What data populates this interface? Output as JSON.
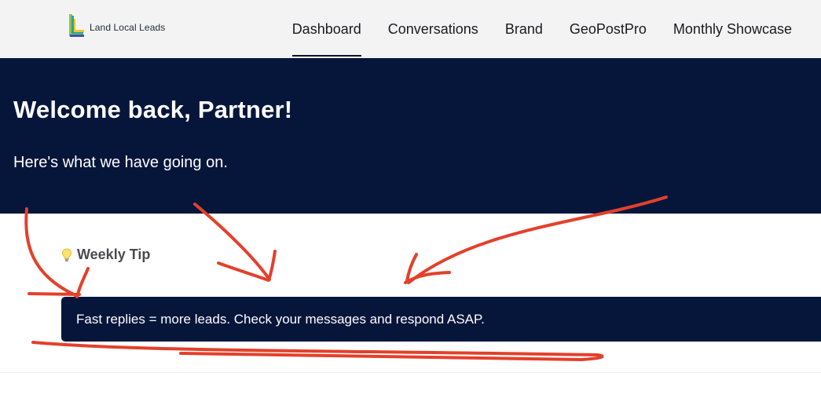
{
  "brand": {
    "name": "Land Local Leads",
    "icon": "logo-icon"
  },
  "nav": {
    "items": [
      {
        "label": "Dashboard",
        "active": true
      },
      {
        "label": "Conversations",
        "active": false
      },
      {
        "label": "Brand",
        "active": false
      },
      {
        "label": "GeoPostPro",
        "active": false
      },
      {
        "label": "Monthly Showcase",
        "active": false
      }
    ]
  },
  "hero": {
    "title": "Welcome back, Partner!",
    "subtitle": "Here's what we have going on."
  },
  "tip": {
    "icon": "lightbulb-icon",
    "title": "Weekly Tip",
    "text": "Fast replies = more leads. Check your messages and respond ASAP."
  },
  "colors": {
    "navy": "#06163b",
    "topbar": "#f3f3f4",
    "annotation": "#e3402b"
  }
}
